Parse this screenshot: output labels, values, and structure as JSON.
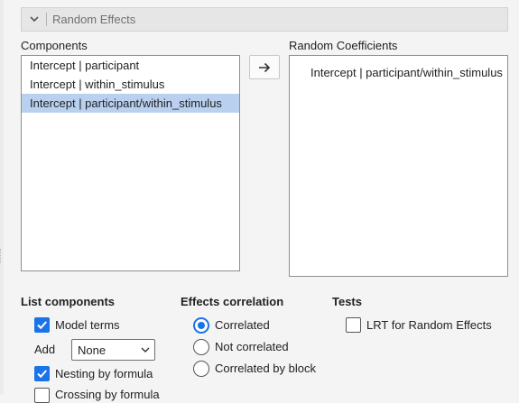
{
  "section": {
    "title": "Random Effects"
  },
  "components": {
    "label": "Components",
    "items": [
      "Intercept | participant",
      "Intercept | within_stimulus",
      "Intercept | participant/within_stimulus"
    ],
    "selected_index": 2
  },
  "move_button": {
    "icon": "arrow-right-icon",
    "symbol": "→"
  },
  "random_coefficients": {
    "label": "Random Coefficients",
    "items": [
      "Intercept | participant/within_stimulus"
    ]
  },
  "list_components": {
    "heading": "List components",
    "model_terms": {
      "label": "Model terms",
      "checked": true
    },
    "add": {
      "label": "Add",
      "value": "None"
    },
    "nesting": {
      "label": "Nesting by formula",
      "checked": true
    },
    "crossing": {
      "label": "Crossing by formula",
      "checked": false
    }
  },
  "effects_correlation": {
    "heading": "Effects correlation",
    "options": [
      {
        "label": "Correlated",
        "checked": true
      },
      {
        "label": "Not correlated",
        "checked": false
      },
      {
        "label": "Correlated by block",
        "checked": false
      }
    ]
  },
  "tests": {
    "heading": "Tests",
    "lrt": {
      "label": "LRT for Random Effects",
      "checked": false
    }
  },
  "colors": {
    "accent": "#1a73e8",
    "selection": "#b9d0ef",
    "header_bg": "#e6e6e6"
  }
}
